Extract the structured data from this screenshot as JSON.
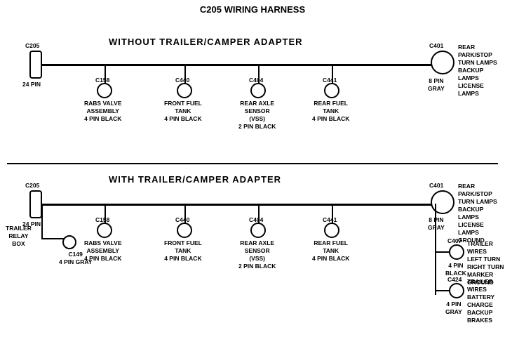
{
  "title": "C205 WIRING HARNESS",
  "top_section": {
    "label": "WITHOUT TRAILER/CAMPER ADAPTER",
    "connectors": [
      {
        "id": "C205_top",
        "label": "C205",
        "sublabel": "24 PIN",
        "type": "rect"
      },
      {
        "id": "C401_top",
        "label": "C401",
        "sublabel": "8 PIN\nGRAY",
        "type": "circle"
      },
      {
        "id": "C158_top",
        "label": "C158",
        "sublabel": "RABS VALVE\nASSEMBLY\n4 PIN BLACK"
      },
      {
        "id": "C440_top",
        "label": "C440",
        "sublabel": "FRONT FUEL\nTANK\n4 PIN BLACK"
      },
      {
        "id": "C404_top",
        "label": "C404",
        "sublabel": "REAR AXLE\nSENSOR\n(VSS)\n2 PIN BLACK"
      },
      {
        "id": "C441_top",
        "label": "C441",
        "sublabel": "REAR FUEL\nTANK\n4 PIN BLACK"
      }
    ],
    "right_label": "REAR PARK/STOP\nTURN LAMPS\nBACKUP LAMPS\nLICENSE LAMPS"
  },
  "bottom_section": {
    "label": "WITH TRAILER/CAMPER ADAPTER",
    "connectors": [
      {
        "id": "C205_bot",
        "label": "C205",
        "sublabel": "24 PIN",
        "type": "rect"
      },
      {
        "id": "C401_bot",
        "label": "C401",
        "sublabel": "8 PIN\nGRAY",
        "type": "circle"
      },
      {
        "id": "C158_bot",
        "label": "C158",
        "sublabel": "RABS VALVE\nASSEMBLY\n4 PIN BLACK"
      },
      {
        "id": "C440_bot",
        "label": "C440",
        "sublabel": "FRONT FUEL\nTANK\n4 PIN BLACK"
      },
      {
        "id": "C404_bot",
        "label": "C404",
        "sublabel": "REAR AXLE\nSENSOR\n(VSS)\n2 PIN BLACK"
      },
      {
        "id": "C441_bot",
        "label": "C441",
        "sublabel": "REAR FUEL\nTANK\n4 PIN BLACK"
      },
      {
        "id": "C149",
        "label": "C149",
        "sublabel": "4 PIN GRAY"
      },
      {
        "id": "C407",
        "label": "C407",
        "sublabel": "4 PIN\nBLACK"
      },
      {
        "id": "C424",
        "label": "C424",
        "sublabel": "4 PIN\nGRAY"
      }
    ],
    "trailer_relay": "TRAILER\nRELAY\nBOX",
    "c407_label": "TRAILER WIRES\nLEFT TURN\nRIGHT TURN\nMARKER\nGROUND",
    "c424_label": "TRAILER WIRES\nBATTERY CHARGE\nBACKUP\nBRAKES",
    "right_label": "REAR PARK/STOP\nTURN LAMPS\nBACKUP LAMPS\nLICENSE LAMPS\nGROUND"
  }
}
